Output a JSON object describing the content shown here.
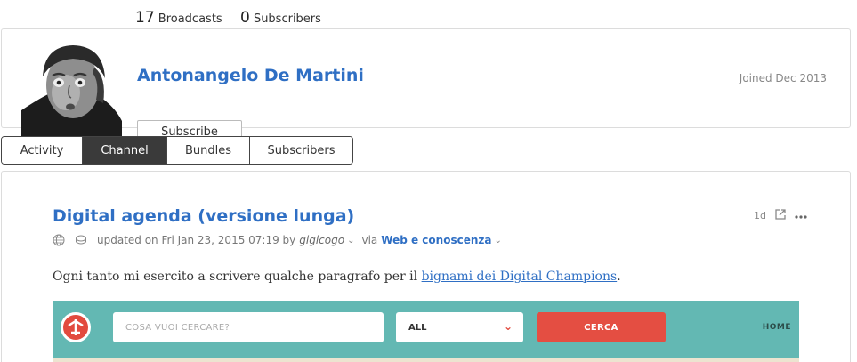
{
  "profile": {
    "broadcasts_count": "17",
    "broadcasts_label": "Broadcasts",
    "subscribers_count": "0",
    "subscribers_label": "Subscribers",
    "name": "Antonangelo De Martini",
    "joined": "Joined Dec 2013",
    "subscribe_label": "Subscribe"
  },
  "tabs": [
    {
      "label": "Activity",
      "active": false
    },
    {
      "label": "Channel",
      "active": true
    },
    {
      "label": "Bundles",
      "active": false
    },
    {
      "label": "Subscribers",
      "active": false
    }
  ],
  "post": {
    "title": "Digital agenda (versione lunga)",
    "meta_updated": "updated on Fri Jan 23, 2015 07:19 by",
    "author": "gigicogo",
    "via": "via",
    "collection": "Web e conoscenza",
    "age": "1d",
    "body_prefix": "Ogni tanto mi esercito a scrivere qualche paragrafo per il",
    "body_link": "bignami dei Digital Champions",
    "body_suffix": ".",
    "icons": {
      "public": "globe-icon",
      "type": "stack-icon",
      "external": "external-link-icon",
      "more": "more-dots-icon"
    }
  },
  "embed": {
    "search_placeholder": "COSA VUOI CERCARE?",
    "select_value": "ALL",
    "search_button": "CERCA",
    "nav_home": "HOME",
    "colors": {
      "background": "#63b8b3",
      "button": "#e44e42"
    }
  },
  "colors": {
    "link": "#2f6fc4",
    "active_tab": "#3a3a3a"
  }
}
